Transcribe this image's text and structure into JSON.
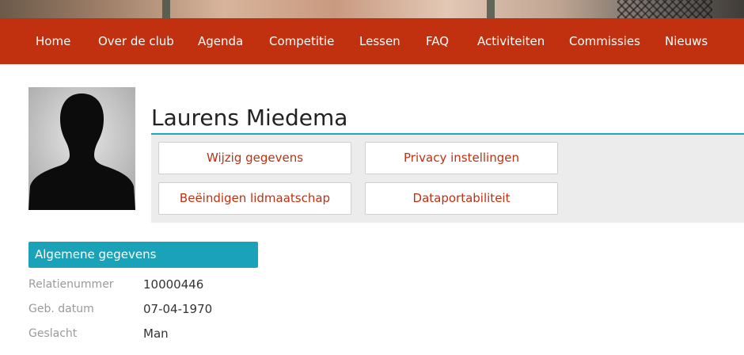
{
  "nav": {
    "items": [
      "Home",
      "Over de club",
      "Agenda",
      "Competitie",
      "Lessen",
      "FAQ",
      "Activiteiten",
      "Commissies",
      "Nieuws"
    ]
  },
  "profile": {
    "name": "Laurens Miedema",
    "avatar_icon": "person-silhouette-icon"
  },
  "actions": {
    "edit": "Wijzig gegevens",
    "privacy": "Privacy instellingen",
    "end_membership": "Beëindigen lidmaatschap",
    "data_portability": "Dataportabiliteit"
  },
  "general": {
    "title": "Algemene gegevens",
    "rows": [
      {
        "label": "Relatienummer",
        "value": "10000446"
      },
      {
        "label": "Geb. datum",
        "value": "07-04-1970"
      },
      {
        "label": "Geslacht",
        "value": "Man"
      }
    ]
  },
  "colors": {
    "nav_bg": "#c1300f",
    "accent": "#1aa3b8",
    "button_text": "#c1300f"
  }
}
